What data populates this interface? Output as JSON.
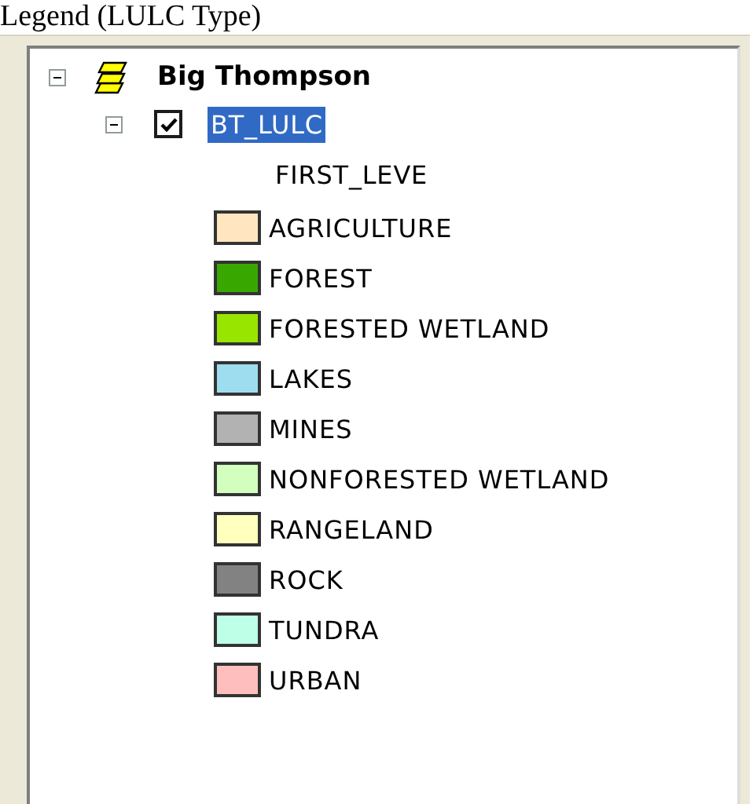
{
  "caption": "Legend (LULC Type)",
  "toc": {
    "group": {
      "name": "Big Thompson",
      "expanded": true,
      "layers": [
        {
          "name": "BT_LULC",
          "expanded": true,
          "checked": true,
          "selected": true,
          "field": "FIRST_LEVE",
          "classes": [
            {
              "label": "AGRICULTURE",
              "color": "#ffe6c0"
            },
            {
              "label": "FOREST",
              "color": "#38a800"
            },
            {
              "label": "FORESTED WETLAND",
              "color": "#98e600"
            },
            {
              "label": "LAKES",
              "color": "#9edcf0"
            },
            {
              "label": "MINES",
              "color": "#b2b2b2"
            },
            {
              "label": "NONFORESTED WETLAND",
              "color": "#d3ffbe"
            },
            {
              "label": "RANGELAND",
              "color": "#ffffbe"
            },
            {
              "label": "ROCK",
              "color": "#828282"
            },
            {
              "label": "TUNDRA",
              "color": "#beffe8"
            },
            {
              "label": "URBAN",
              "color": "#ffbebe"
            }
          ]
        }
      ]
    }
  }
}
